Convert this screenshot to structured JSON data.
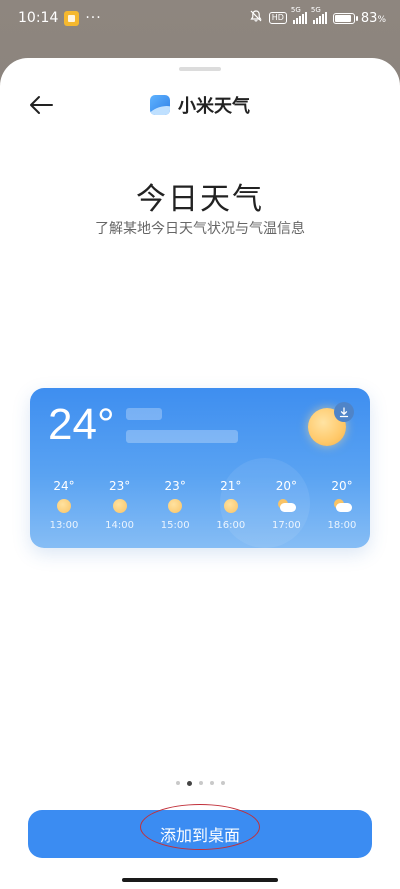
{
  "status_bar": {
    "time": "10:14",
    "more": "···",
    "hd": "HD",
    "signal1_label": "5G",
    "signal2_label": "5G",
    "battery_percent": "83",
    "battery_level": 0.83,
    "colors": {
      "notif_icon": "#f5b82e"
    }
  },
  "header": {
    "back_icon": "arrow-left-icon",
    "app_icon": "mi-weather-app-icon",
    "title": "小米天气"
  },
  "page": {
    "title": "今日天气",
    "subtitle": "了解某地今日天气状况与气温信息"
  },
  "widget": {
    "current_temp": "24°",
    "main_icon": "sun-icon",
    "badge_icon": "download-icon",
    "forecast": [
      {
        "temp": "24°",
        "icon": "sun-icon",
        "time": "13:00"
      },
      {
        "temp": "23°",
        "icon": "sun-icon",
        "time": "14:00"
      },
      {
        "temp": "23°",
        "icon": "sun-icon",
        "time": "15:00"
      },
      {
        "temp": "21°",
        "icon": "sun-icon",
        "time": "16:00"
      },
      {
        "temp": "20°",
        "icon": "partly-cloudy-icon",
        "time": "17:00"
      },
      {
        "temp": "20°",
        "icon": "partly-cloudy-icon",
        "time": "18:00"
      }
    ],
    "colors": {
      "gradient_top": "#3e8ef0",
      "gradient_bottom": "#86bdf5",
      "sun": "#ffc96a"
    }
  },
  "pager": {
    "count": 5,
    "active_index": 1
  },
  "actions": {
    "add_button_label": "添加到桌面",
    "button_color": "#3b8cf2",
    "annotation_color": "#c1303a"
  }
}
